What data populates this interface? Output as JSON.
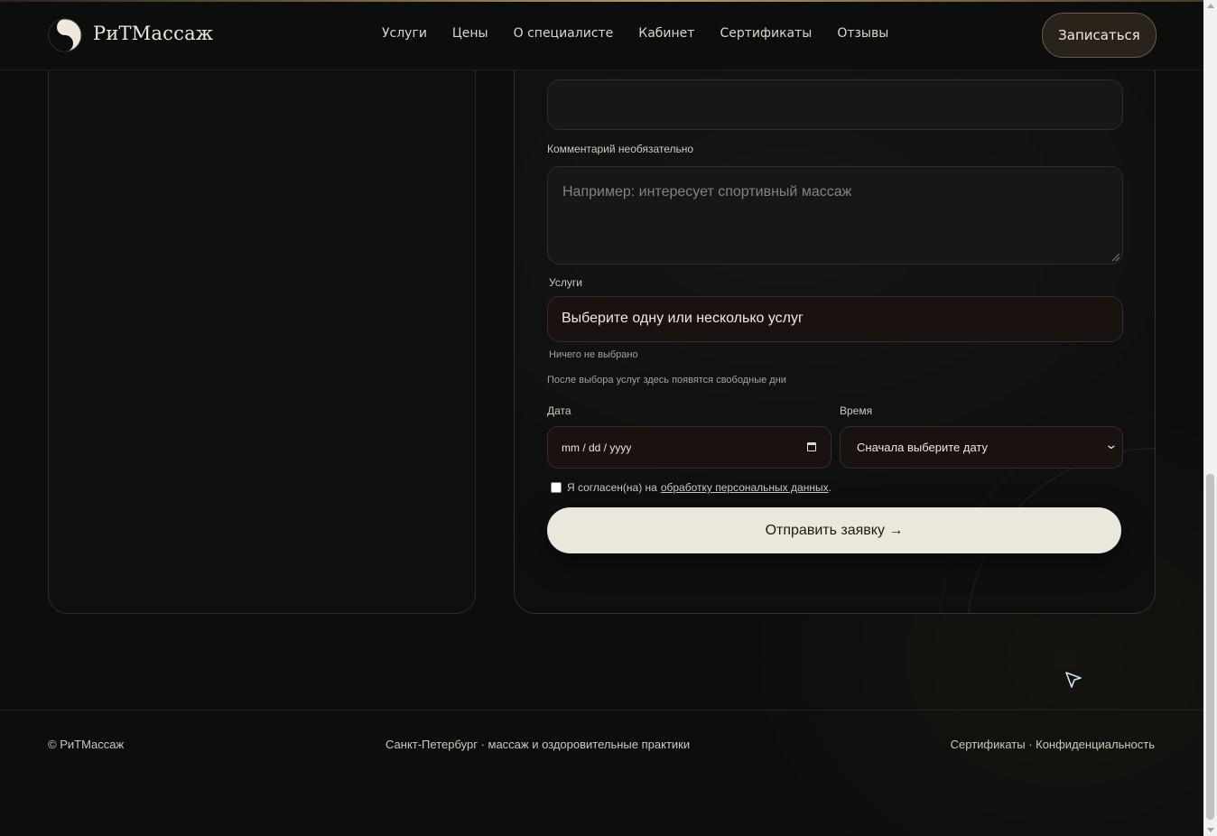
{
  "header": {
    "brand": "РиТМассаж",
    "nav": [
      "Услуги",
      "Цены",
      "О специалисте",
      "Кабинет",
      "Сертификаты",
      "Отзывы"
    ],
    "cta_label": "Записаться"
  },
  "form": {
    "comment_label": "Комментарий необязательно",
    "comment_placeholder": "Например: интересует спортивный массаж",
    "services_label": "Услуги",
    "services_select": "Выберите одну или несколько услуг",
    "services_status": "Ничего не выбрано",
    "services_hint": "После выбора услуг здесь появятся свободные дни",
    "date_label": "Дата",
    "date_value": "mm / dd / yyyy",
    "time_label": "Время",
    "time_value": "Сначала выберите дату",
    "consent_text": "Я согласен(на) на",
    "consent_link": "обработку персональных данных",
    "consent_end": ".",
    "submit_label": "Отправить заявку →"
  },
  "footer": {
    "copyright": "© РиТМассаж",
    "tagline": "Санкт-Петербург · массаж и оздоровительные практики",
    "links": "Сертификаты · Конфиденциальность"
  },
  "colors": {
    "background": "#0c0e0d",
    "accent": "#b8995e",
    "button_light": "#ece7dc"
  }
}
